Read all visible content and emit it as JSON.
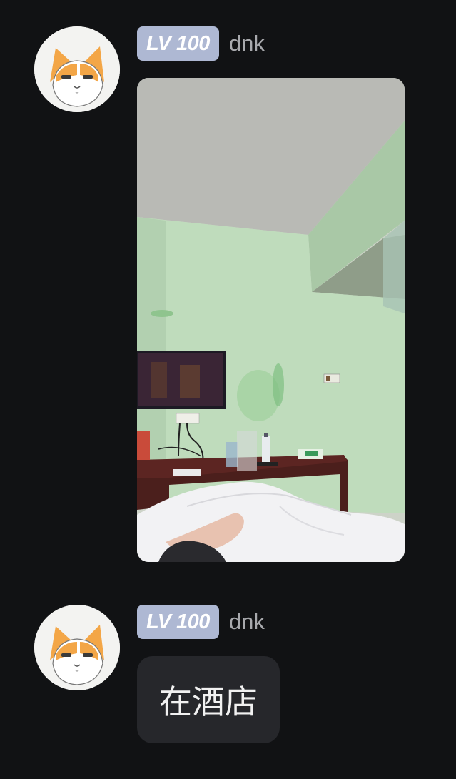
{
  "messages": [
    {
      "avatar_icon": "cat-face-avatar",
      "level_badge": "LV 100",
      "username": "dnk",
      "content_type": "image",
      "image_description": "hotel room photo"
    },
    {
      "avatar_icon": "cat-face-avatar",
      "level_badge": "LV 100",
      "username": "dnk",
      "content_type": "text",
      "text": "在酒店"
    }
  ],
  "colors": {
    "background": "#111214",
    "badge": "#aeb8d3",
    "username": "#a8a9ad",
    "bubble": "#26272b"
  }
}
